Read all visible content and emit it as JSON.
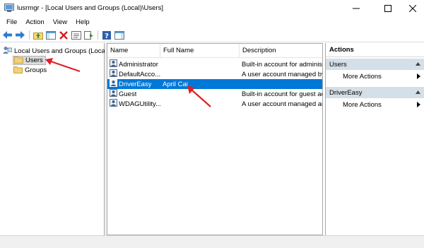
{
  "window": {
    "title": "lusrmgr - [Local Users and Groups (Local)\\Users]",
    "controls": [
      "minimize",
      "maximize",
      "close"
    ]
  },
  "menu": [
    "File",
    "Action",
    "View",
    "Help"
  ],
  "toolbar_icons": [
    "back-icon",
    "forward-icon",
    "up-folder-icon",
    "show-hide-tree-icon",
    "delete-icon",
    "properties-icon",
    "export-list-icon",
    "help-icon",
    "show-hide-action-pane-icon"
  ],
  "tree": {
    "root": "Local Users and Groups (Local)",
    "children": [
      {
        "label": "Users",
        "selected": true
      },
      {
        "label": "Groups",
        "selected": false
      }
    ]
  },
  "list": {
    "columns": [
      "Name",
      "Full Name",
      "Description"
    ],
    "rows": [
      {
        "name": "Administrator",
        "full_name": "",
        "description": "Built-in account for administ",
        "selected": false
      },
      {
        "name": "DefaultAcco...",
        "full_name": "",
        "description": "A user account managed by",
        "selected": false
      },
      {
        "name": "DriverEasy",
        "full_name": "April Cai",
        "description": "",
        "selected": true
      },
      {
        "name": "Guest",
        "full_name": "",
        "description": "Built-in account for guest ac",
        "selected": false
      },
      {
        "name": "WDAGUtility...",
        "full_name": "",
        "description": "A user account managed an",
        "selected": false
      }
    ]
  },
  "actions": {
    "title": "Actions",
    "sections": [
      {
        "header": "Users",
        "items": [
          "More Actions"
        ]
      },
      {
        "header": "DriverEasy",
        "items": [
          "More Actions"
        ]
      }
    ]
  },
  "colors": {
    "selection": "#0078d7",
    "action_header_bg": "#d5dfe8",
    "annotation_arrow": "#e0202a"
  }
}
